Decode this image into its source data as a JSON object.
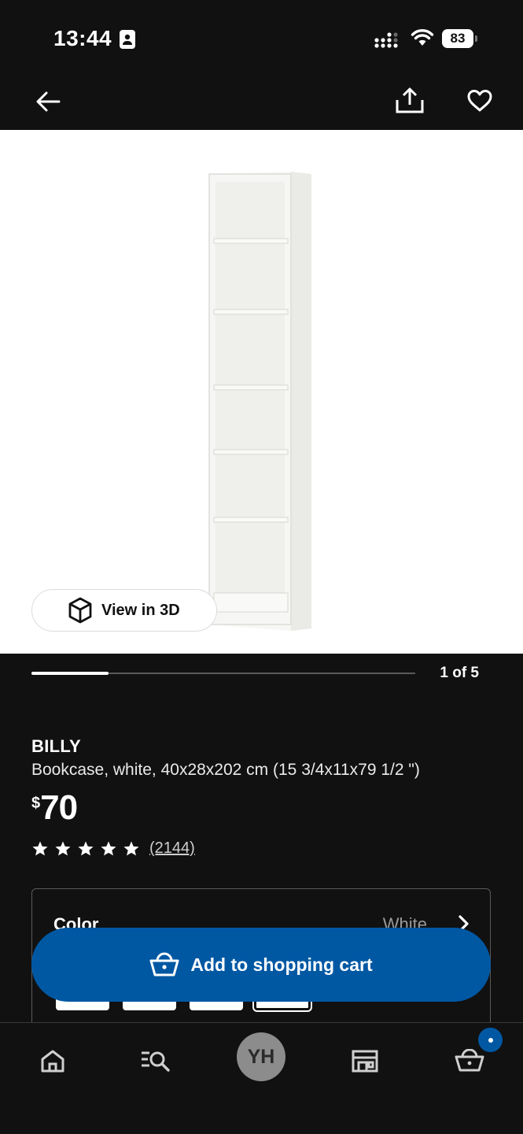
{
  "status_bar": {
    "time": "13:44",
    "battery": "83"
  },
  "nav": {
    "back": "back",
    "share": "share",
    "favorite": "favorite"
  },
  "gallery": {
    "view_3d_label": "View in 3D",
    "page_counter": "1 of 5",
    "current_page": 1,
    "total_pages": 5
  },
  "product": {
    "name": "BILLY",
    "description": "Bookcase, white, 40x28x202 cm (15 3/4x11x79 1/2 \")",
    "price_currency": "$",
    "price_value": "70",
    "rating": 5,
    "review_count": "(2144)"
  },
  "options": {
    "color_label": "Color",
    "color_value": "White"
  },
  "cart_button_label": "Add to shopping cart",
  "tab_bar": {
    "avatar_initials": "YH"
  },
  "colors": {
    "accent": "#0058a3",
    "background": "#111112"
  }
}
